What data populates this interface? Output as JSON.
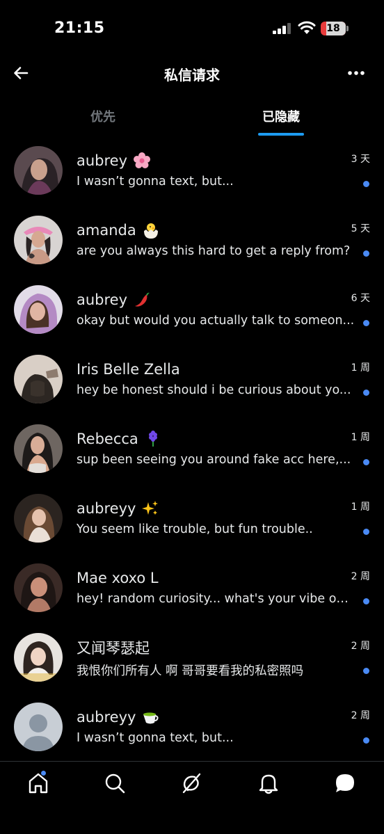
{
  "status_bar": {
    "time": "21:15",
    "battery": "18"
  },
  "header": {
    "title": "私信请求"
  },
  "tabs": [
    {
      "label": "优先",
      "active": false
    },
    {
      "label": "已隐藏",
      "active": true
    }
  ],
  "messages": [
    {
      "name": "aubrey",
      "emoji": "cherry-blossom-icon",
      "preview": "I wasn’t gonna text, but...",
      "time": "3 天",
      "unread": true
    },
    {
      "name": "amanda",
      "emoji": "hatching-chick-icon",
      "preview": "are you always this hard to get a reply from?",
      "time": "5 天",
      "unread": true
    },
    {
      "name": "aubrey",
      "emoji": "hot-pepper-icon",
      "preview": "okay but would you actually talk to someon...",
      "time": "6 天",
      "unread": true
    },
    {
      "name": "Iris Belle Zella",
      "emoji": "",
      "preview": "hey be honest should i be curious about yo...",
      "time": "1 周",
      "unread": true
    },
    {
      "name": "Rebecca",
      "emoji": "hyacinth-icon",
      "preview": "sup been seeing you around fake acc here,...",
      "time": "1 周",
      "unread": true
    },
    {
      "name": "aubreyy",
      "emoji": "sparkles-icon",
      "preview": "You seem like trouble, but fun trouble..",
      "time": "1 周",
      "unread": true
    },
    {
      "name": "Mae xoxo L",
      "emoji": "",
      "preview": "hey! random curiosity... what's your vibe on...",
      "time": "2 周",
      "unread": true
    },
    {
      "name": "又闻琴瑟起",
      "emoji": "",
      "preview": "我恨你们所有人 啊 哥哥要看我的私密照吗",
      "time": "2 周",
      "unread": true
    },
    {
      "name": "aubreyy",
      "emoji": "teacup-icon",
      "preview": "I wasn’t gonna text, but...",
      "time": "2 周",
      "unread": true
    }
  ],
  "colors": {
    "accent": "#1d9bf0",
    "unread": "#4a8af4",
    "battery_low": "#e83b3b"
  },
  "nav": [
    "home-icon",
    "search-icon",
    "grok-icon",
    "bell-icon",
    "messages-icon"
  ]
}
